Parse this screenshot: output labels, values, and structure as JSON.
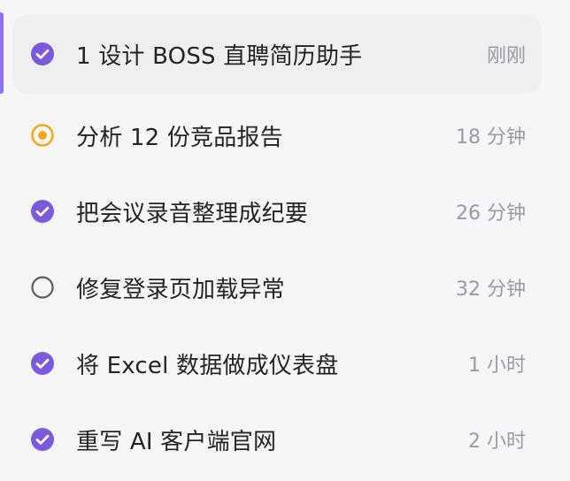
{
  "tasks": [
    {
      "status": "done",
      "status_icon": "check-circle-icon",
      "title": "1 设计 BOSS 直聘简历助手",
      "time": "刚刚",
      "selected": true
    },
    {
      "status": "in-progress",
      "status_icon": "progress-dot-icon",
      "title": "分析 12 份竞品报告",
      "time": "18 分钟",
      "selected": false
    },
    {
      "status": "done",
      "status_icon": "check-circle-icon",
      "title": "把会议录音整理成纪要",
      "time": "26 分钟",
      "selected": false
    },
    {
      "status": "todo",
      "status_icon": "empty-circle-icon",
      "title": "修复登录页加载异常",
      "time": "32 分钟",
      "selected": false
    },
    {
      "status": "done",
      "status_icon": "check-circle-icon",
      "title": "将 Excel 数据做成仪表盘",
      "time": "1 小时",
      "selected": false
    },
    {
      "status": "done",
      "status_icon": "check-circle-icon",
      "title": "重写 AI 客户端官网",
      "time": "2 小时",
      "selected": false
    }
  ],
  "colors": {
    "accent_purple": "#7b5bd9",
    "progress_orange": "#f2a81d",
    "todo_gray": "#5c5c63",
    "text_primary": "#242424",
    "text_secondary": "#9a9aa2"
  }
}
